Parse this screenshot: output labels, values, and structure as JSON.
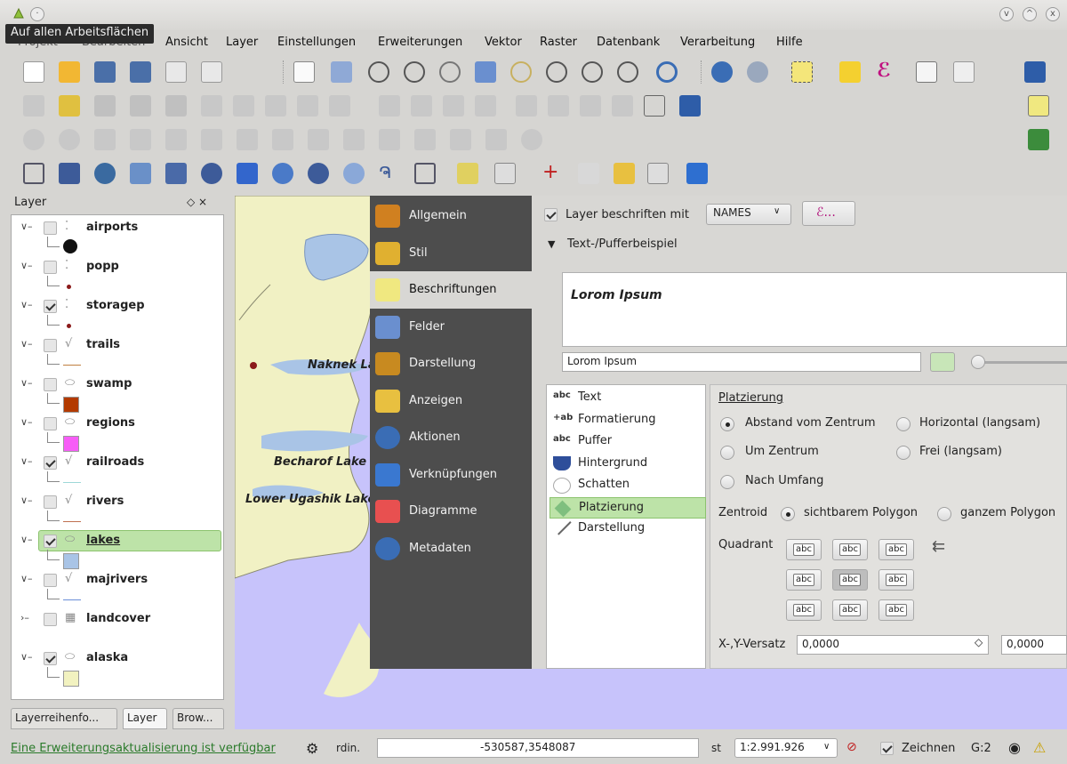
{
  "tooltip": "Auf allen Arbeitsflächen",
  "menu": [
    "Projekt",
    "Bearbeiten",
    "Ansicht",
    "Layer",
    "Einstellungen",
    "Erweiterungen",
    "Vektor",
    "Raster",
    "Datenbank",
    "Verarbeitung",
    "Hilfe"
  ],
  "window_buttons": [
    "v",
    "^",
    "x"
  ],
  "layer_panel": {
    "title": "Layer",
    "controls": "◇ ×",
    "layers": [
      {
        "name": "airports",
        "checked": false,
        "geom": "point",
        "legend": "airport-symbol"
      },
      {
        "name": "popp",
        "checked": false,
        "geom": "point",
        "legend": "dot",
        "legend_color": "#8b1a1a"
      },
      {
        "name": "storagep",
        "checked": true,
        "geom": "point",
        "legend": "dot",
        "legend_color": "#8b1a1a"
      },
      {
        "name": "trails",
        "checked": false,
        "geom": "line",
        "legend": "line",
        "legend_color": "#c08040"
      },
      {
        "name": "swamp",
        "checked": false,
        "geom": "polygon",
        "legend": "fill",
        "legend_color": "#b33a00"
      },
      {
        "name": "regions",
        "checked": false,
        "geom": "polygon",
        "legend": "fill",
        "legend_color": "#f75df7"
      },
      {
        "name": "railroads",
        "checked": true,
        "geom": "line",
        "legend": "line",
        "legend_color": "#9ed8d8"
      },
      {
        "name": "rivers",
        "checked": false,
        "geom": "line",
        "legend": "line",
        "legend_color": "#c07050"
      },
      {
        "name": "lakes",
        "checked": true,
        "geom": "polygon",
        "legend": "fill",
        "legend_color": "#a9c4e6",
        "selected": true
      },
      {
        "name": "majrivers",
        "checked": false,
        "geom": "line",
        "legend": "line",
        "legend_color": "#6a8ed8"
      },
      {
        "name": "landcover",
        "checked": false,
        "geom": "raster",
        "legend": "none",
        "collapsed": true
      },
      {
        "name": "alaska",
        "checked": true,
        "geom": "polygon",
        "legend": "fill",
        "legend_color": "#f2f2c0"
      }
    ],
    "tabs": [
      "Layerreihenfo...",
      "Layer",
      "Brow..."
    ]
  },
  "map_labels": [
    "Naknek La",
    "Becharof Lake",
    "Lower Ugashik Lake"
  ],
  "dialog": {
    "nav": [
      "Allgemein",
      "Stil",
      "Beschriftungen",
      "Felder",
      "Darstellung",
      "Anzeigen",
      "Aktionen",
      "Verknüpfungen",
      "Diagramme",
      "Metadaten"
    ],
    "nav_selected": "Beschriftungen",
    "label_with_checkbox": "Layer beschriften mit",
    "label_field": "NAMES",
    "expr_button": "ℰ...",
    "section_title": "Text-/Pufferbeispiel",
    "preview_text": "Lorom Ipsum",
    "preview_input": "Lorom Ipsum",
    "sublist": [
      {
        "icon": "abc",
        "label": "Text"
      },
      {
        "icon": "+ab",
        "label": "Formatierung"
      },
      {
        "icon": "abc",
        "label": "Puffer"
      },
      {
        "icon": "shield",
        "label": "Hintergrund"
      },
      {
        "icon": "shadow",
        "label": "Schatten"
      },
      {
        "icon": "move",
        "label": "Platzierung"
      },
      {
        "icon": "brush",
        "label": "Darstellung"
      }
    ],
    "sublist_selected": "Platzierung",
    "placement": {
      "title": "Platzierung",
      "options": [
        "Abstand vom Zentrum",
        "Horizontal (langsam)",
        "Um Zentrum",
        "Frei (langsam)",
        "Nach Umfang"
      ],
      "selected": "Abstand vom Zentrum",
      "centroid_label": "Zentroid",
      "centroid_options": [
        "sichtbarem Polygon",
        "ganzem Polygon"
      ],
      "centroid_selected": "sichtbarem Polygon",
      "quadrant_label": "Quadrant",
      "quadrant_text": "abc",
      "offset_label": "X-,Y-Versatz",
      "offset_x": "0,0000",
      "offset_y": "0,0000"
    }
  },
  "statusbar": {
    "update_link": "Eine Erweiterungsaktualisierung ist verfügbar",
    "coord_label": "rdin.",
    "coord_value": "-530587,3548087",
    "scale_label": "st",
    "scale_value": "1:2.991.926",
    "render_label": "Zeichnen",
    "epsg": "G:2"
  }
}
